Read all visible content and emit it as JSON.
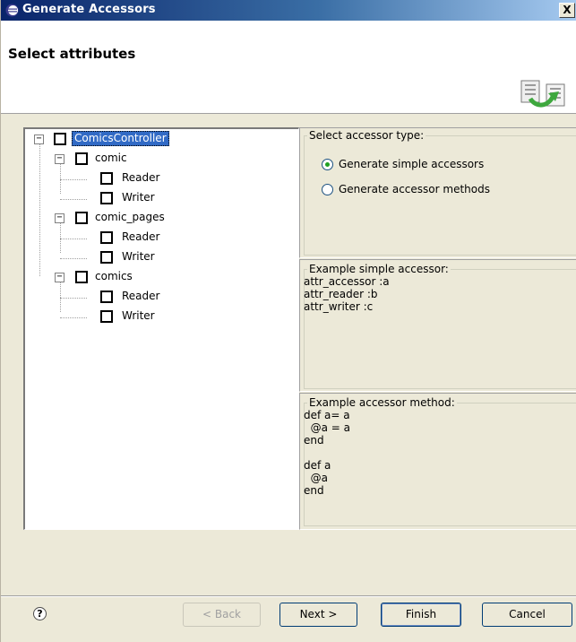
{
  "window": {
    "title": "Generate Accessors",
    "close_label": "X"
  },
  "header": {
    "page_title": "Select attributes"
  },
  "tree": {
    "root": {
      "label": "ComicsController",
      "checked": false,
      "expanded": true,
      "selected": true
    },
    "children": [
      {
        "label": "comic",
        "checked": false,
        "expanded": true,
        "children": [
          {
            "label": "Reader",
            "checked": false
          },
          {
            "label": "Writer",
            "checked": false
          }
        ]
      },
      {
        "label": "comic_pages",
        "checked": false,
        "expanded": true,
        "children": [
          {
            "label": "Reader",
            "checked": false
          },
          {
            "label": "Writer",
            "checked": false
          }
        ]
      },
      {
        "label": "comics",
        "checked": false,
        "expanded": true,
        "children": [
          {
            "label": "Reader",
            "checked": false
          },
          {
            "label": "Writer",
            "checked": false
          }
        ]
      }
    ]
  },
  "accessor_type": {
    "legend": "Select accessor type:",
    "options": [
      {
        "label": "Generate simple accessors",
        "checked": true
      },
      {
        "label": "Generate accessor methods",
        "checked": false
      }
    ]
  },
  "example_simple": {
    "legend": "Example simple accessor:",
    "code": "attr_accessor :a\nattr_reader :b\nattr_writer :c"
  },
  "example_method": {
    "legend": "Example accessor method:",
    "code": "def a= a\n  @a = a\nend\n\ndef a\n  @a\nend"
  },
  "buttons": {
    "help": "?",
    "back": "< Back",
    "next": "Next >",
    "finish": "Finish",
    "cancel": "Cancel"
  }
}
